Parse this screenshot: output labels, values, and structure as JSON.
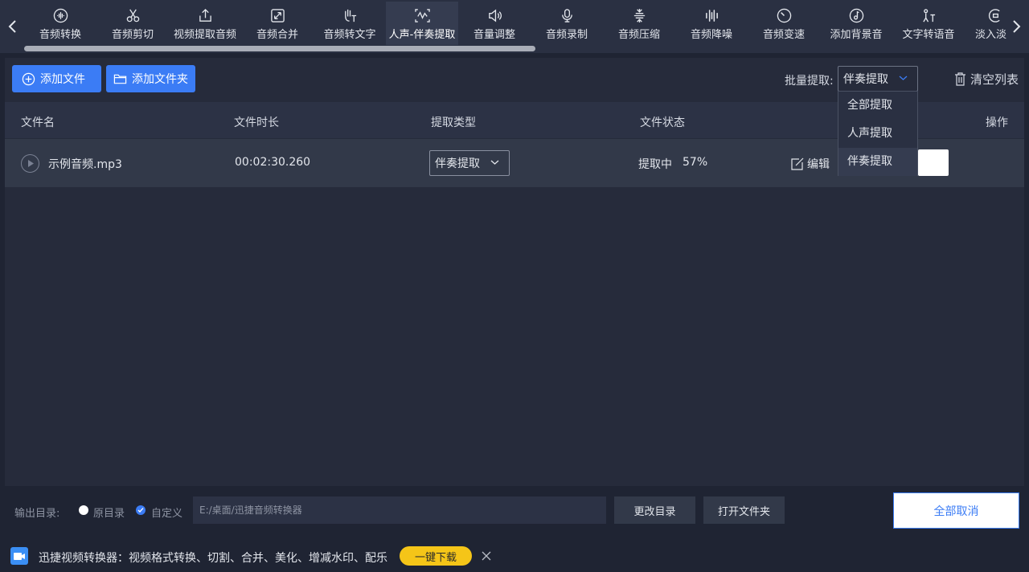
{
  "toolbar": {
    "tools": [
      {
        "label": "音频转换",
        "icon": "waveform-circle-icon"
      },
      {
        "label": "音频剪切",
        "icon": "scissors-icon"
      },
      {
        "label": "视频提取音频",
        "icon": "upload-icon"
      },
      {
        "label": "音频合并",
        "icon": "merge-arrows-icon"
      },
      {
        "label": "音频转文字",
        "icon": "hand-text-icon"
      },
      {
        "label": "人声-伴奏提取",
        "icon": "wave-separate-icon",
        "active": true
      },
      {
        "label": "音量调整",
        "icon": "speaker-icon"
      },
      {
        "label": "音频录制",
        "icon": "microphone-icon"
      },
      {
        "label": "音频压缩",
        "icon": "compress-icon"
      },
      {
        "label": "音频降噪",
        "icon": "noise-bars-icon"
      },
      {
        "label": "音频变速",
        "icon": "speed-clock-icon"
      },
      {
        "label": "添加背景音",
        "icon": "music-note-icon"
      },
      {
        "label": "文字转语音",
        "icon": "text-speech-icon"
      },
      {
        "label": "淡入淡",
        "icon": "fade-icon"
      }
    ]
  },
  "actions": {
    "add_file": "添加文件",
    "add_folder": "添加文件夹",
    "batch_label": "批量提取:",
    "batch_value": "伴奏提取",
    "clear_list": "清空列表"
  },
  "dropdown": {
    "options": [
      "全部提取",
      "人声提取",
      "伴奏提取"
    ],
    "selected_index": 2
  },
  "table": {
    "headers": [
      "文件名",
      "文件时长",
      "提取类型",
      "文件状态",
      "操作"
    ],
    "rows": [
      {
        "name": "示例音频.mp3",
        "duration": "00:02:30.260",
        "type": "伴奏提取",
        "status": "提取中",
        "progress": "57%",
        "edit": "编辑"
      }
    ]
  },
  "output": {
    "label": "输出目录:",
    "option_original": "原目录",
    "option_custom": "自定义",
    "path_placeholder": "E:/桌面/迅捷音频转换器",
    "change_dir": "更改目录",
    "open_folder": "打开文件夹",
    "cancel_all": "全部取消"
  },
  "ad": {
    "text": "迅捷视频转换器：视频格式转换、切割、合并、美化、增减水印、配乐",
    "button": "一键下载"
  },
  "colors": {
    "background": "#1f2433",
    "panel": "#262b3b",
    "accent": "#3b7cf5",
    "ad_button": "#f5c518"
  }
}
